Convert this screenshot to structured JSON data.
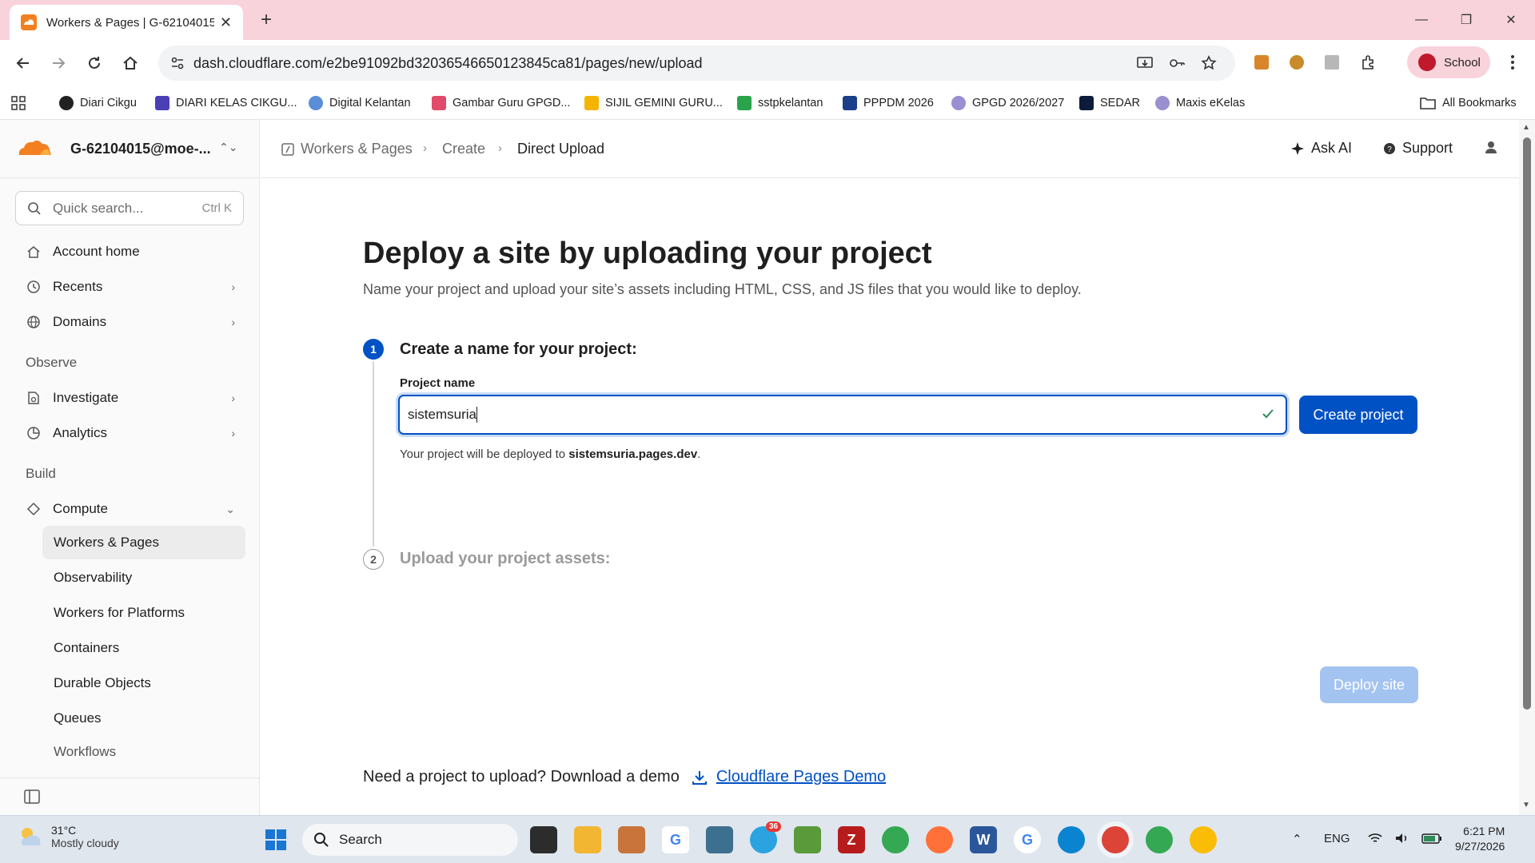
{
  "browser": {
    "tab_title": "Workers & Pages | G-62104015",
    "url": "dash.cloudflare.com/e2be91092bd32036546650123845ca81/pages/new/upload",
    "profile_label": "School",
    "bookmarks": [
      "Diari Cikgu",
      "DIARI KELAS CIKGU...",
      "Digital Kelantan",
      "Gambar Guru GPGD...",
      "SIJIL GEMINI GURU...",
      "sstpkelantan",
      "PPPDM 2026",
      "GPGD 2026/2027",
      "SEDAR",
      "Maxis eKelas"
    ],
    "all_bookmarks": "All Bookmarks"
  },
  "sidebar": {
    "account": "G-62104015@moe-...",
    "search_placeholder": "Quick search...",
    "search_shortcut": "Ctrl K",
    "items": {
      "account_home": "Account home",
      "recents": "Recents",
      "domains": "Domains",
      "observe": "Observe",
      "investigate": "Investigate",
      "analytics": "Analytics",
      "build": "Build",
      "compute": "Compute"
    },
    "compute_children": [
      "Workers & Pages",
      "Observability",
      "Workers for Platforms",
      "Containers",
      "Durable Objects",
      "Queues",
      "Workflows"
    ]
  },
  "header": {
    "breadcrumbs": [
      "Workers & Pages",
      "Create",
      "Direct Upload"
    ],
    "ask_ai": "Ask AI",
    "support": "Support"
  },
  "main": {
    "title": "Deploy a site by uploading your project",
    "subtitle": "Name your project and upload your site’s assets including HTML, CSS, and JS files that you would like to deploy.",
    "step1_num": "1",
    "step1_title": "Create a name for your project:",
    "project_name_label": "Project name",
    "project_name_value": "sistemsuria",
    "create_button": "Create project",
    "deploy_note_prefix": "Your project will be deployed to ",
    "deploy_note_domain": "sistemsuria.pages.dev",
    "deploy_note_suffix": ".",
    "step2_num": "2",
    "step2_title": "Upload your project assets:",
    "deploy_button": "Deploy site",
    "demo_text": "Need a project to upload? Download a demo",
    "demo_link": "Cloudflare Pages Demo"
  },
  "taskbar": {
    "temperature": "31°C",
    "condition": "Mostly cloudy",
    "search": "Search",
    "language": "ENG",
    "time": "6:21 PM",
    "date": "9/27/2026",
    "telegram_badge": "36"
  },
  "colors": {
    "accent": "#0051c3",
    "cloudflare_orange": "#f38020",
    "tab_strip": "#f9d3dc"
  }
}
